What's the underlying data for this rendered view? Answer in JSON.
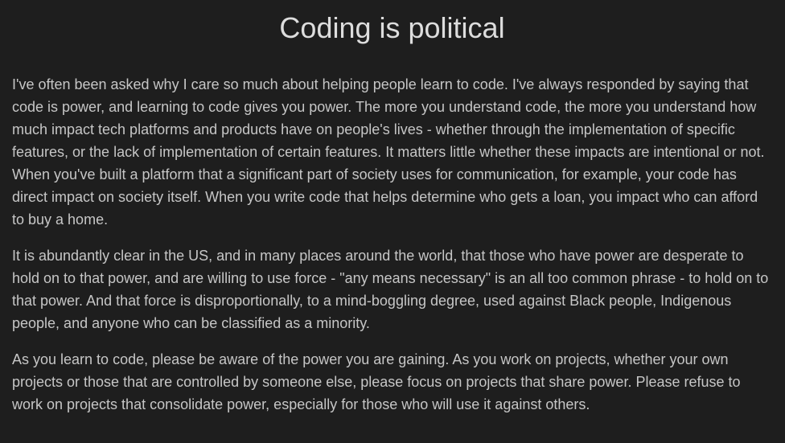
{
  "article": {
    "title": "Coding is political",
    "paragraphs": [
      "I've often been asked why I care so much about helping people learn to code. I've always responded by saying that code is power, and learning to code gives you power. The more you understand code, the more you understand how much impact tech platforms and products have on people's lives - whether through the implementation of specific features, or the lack of implementation of certain features. It matters little whether these impacts are intentional or not. When you've built a platform that a significant part of society uses for communication, for example, your code has direct impact on society itself. When you write code that helps determine who gets a loan, you impact who can afford to buy a home.",
      "It is abundantly clear in the US, and in many places around the world, that those who have power are desperate to hold on to that power, and are willing to use force - \"any means necessary\" is an all too common phrase - to hold on to that power. And that force is disproportionally, to a mind-boggling degree, used against Black people, Indigenous people, and anyone who can be classified as a minority.",
      "As you learn to code, please be aware of the power you are gaining. As you work on projects, whether your own projects or those that are controlled by someone else, please focus on projects that share power. Please refuse to work on projects that consolidate power, especially for those who will use it against others."
    ]
  }
}
